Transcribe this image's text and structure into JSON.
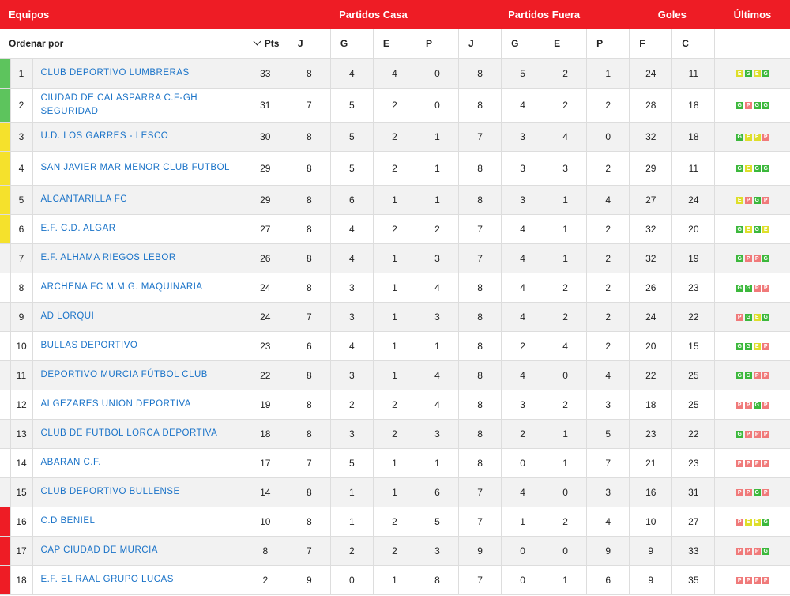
{
  "header": {
    "teams": "Equipos",
    "home": "Partidos Casa",
    "away": "Partidos Fuera",
    "goals": "Goles",
    "last": "Últimos"
  },
  "subheader": {
    "sort_by": "Ordenar por",
    "pts": "Pts",
    "home_cols": [
      "J",
      "G",
      "E",
      "P"
    ],
    "away_cols": [
      "J",
      "G",
      "E",
      "P"
    ],
    "goal_cols": [
      "F",
      "C"
    ]
  },
  "colors": {
    "accent": "#ee1c25",
    "link": "#1a73c8",
    "zone_green": "#5dc45d",
    "zone_yellow": "#f5e12c",
    "zone_red": "#ee1c25",
    "result_win": "#3cb83c",
    "result_draw": "#dede2a",
    "result_loss": "#f07a7a"
  },
  "rows": [
    {
      "pos": "1",
      "team": "CLUB DEPORTIVO LUMBRERAS",
      "pts": "33",
      "home": [
        "8",
        "4",
        "4",
        "0"
      ],
      "away": [
        "8",
        "5",
        "2",
        "1"
      ],
      "gf": "24",
      "ga": "11",
      "zone": "green",
      "last": [
        "E",
        "G",
        "E",
        "G"
      ]
    },
    {
      "pos": "2",
      "team": "CIUDAD DE CALASPARRA C.F-GH SEGURIDAD",
      "pts": "31",
      "home": [
        "7",
        "5",
        "2",
        "0"
      ],
      "away": [
        "8",
        "4",
        "2",
        "2"
      ],
      "gf": "28",
      "ga": "18",
      "zone": "green",
      "last": [
        "G",
        "P",
        "G",
        "G"
      ]
    },
    {
      "pos": "3",
      "team": "U.D. LOS GARRES - LESCO",
      "pts": "30",
      "home": [
        "8",
        "5",
        "2",
        "1"
      ],
      "away": [
        "7",
        "3",
        "4",
        "0"
      ],
      "gf": "32",
      "ga": "18",
      "zone": "yellow",
      "last": [
        "G",
        "E",
        "E",
        "P"
      ]
    },
    {
      "pos": "4",
      "team": "SAN JAVIER MAR MENOR CLUB FUTBOL",
      "pts": "29",
      "home": [
        "8",
        "5",
        "2",
        "1"
      ],
      "away": [
        "8",
        "3",
        "3",
        "2"
      ],
      "gf": "29",
      "ga": "11",
      "zone": "yellow",
      "last": [
        "G",
        "E",
        "G",
        "G"
      ]
    },
    {
      "pos": "5",
      "team": "ALCANTARILLA FC",
      "pts": "29",
      "home": [
        "8",
        "6",
        "1",
        "1"
      ],
      "away": [
        "8",
        "3",
        "1",
        "4"
      ],
      "gf": "27",
      "ga": "24",
      "zone": "yellow",
      "last": [
        "E",
        "P",
        "G",
        "P"
      ]
    },
    {
      "pos": "6",
      "team": "E.F. C.D. ALGAR",
      "pts": "27",
      "home": [
        "8",
        "4",
        "2",
        "2"
      ],
      "away": [
        "7",
        "4",
        "1",
        "2"
      ],
      "gf": "32",
      "ga": "20",
      "zone": "yellow",
      "last": [
        "G",
        "E",
        "G",
        "E"
      ]
    },
    {
      "pos": "7",
      "team": "E.F. ALHAMA RIEGOS LEBOR",
      "pts": "26",
      "home": [
        "8",
        "4",
        "1",
        "3"
      ],
      "away": [
        "7",
        "4",
        "1",
        "2"
      ],
      "gf": "32",
      "ga": "19",
      "zone": "none",
      "last": [
        "G",
        "P",
        "P",
        "G"
      ]
    },
    {
      "pos": "8",
      "team": "ARCHENA FC M.M.G. MAQUINARIA",
      "pts": "24",
      "home": [
        "8",
        "3",
        "1",
        "4"
      ],
      "away": [
        "8",
        "4",
        "2",
        "2"
      ],
      "gf": "26",
      "ga": "23",
      "zone": "none",
      "last": [
        "G",
        "G",
        "P",
        "P"
      ]
    },
    {
      "pos": "9",
      "team": "AD LORQUI",
      "pts": "24",
      "home": [
        "7",
        "3",
        "1",
        "3"
      ],
      "away": [
        "8",
        "4",
        "2",
        "2"
      ],
      "gf": "24",
      "ga": "22",
      "zone": "none",
      "last": [
        "P",
        "G",
        "E",
        "G"
      ]
    },
    {
      "pos": "10",
      "team": "BULLAS DEPORTIVO",
      "pts": "23",
      "home": [
        "6",
        "4",
        "1",
        "1"
      ],
      "away": [
        "8",
        "2",
        "4",
        "2"
      ],
      "gf": "20",
      "ga": "15",
      "zone": "none",
      "last": [
        "G",
        "G",
        "E",
        "P"
      ]
    },
    {
      "pos": "11",
      "team": "DEPORTIVO MURCIA FÚTBOL CLUB",
      "pts": "22",
      "home": [
        "8",
        "3",
        "1",
        "4"
      ],
      "away": [
        "8",
        "4",
        "0",
        "4"
      ],
      "gf": "22",
      "ga": "25",
      "zone": "none",
      "last": [
        "G",
        "G",
        "P",
        "P"
      ]
    },
    {
      "pos": "12",
      "team": "ALGEZARES UNION DEPORTIVA",
      "pts": "19",
      "home": [
        "8",
        "2",
        "2",
        "4"
      ],
      "away": [
        "8",
        "3",
        "2",
        "3"
      ],
      "gf": "18",
      "ga": "25",
      "zone": "none",
      "last": [
        "P",
        "P",
        "G",
        "P"
      ]
    },
    {
      "pos": "13",
      "team": "CLUB DE FUTBOL LORCA DEPORTIVA",
      "pts": "18",
      "home": [
        "8",
        "3",
        "2",
        "3"
      ],
      "away": [
        "8",
        "2",
        "1",
        "5"
      ],
      "gf": "23",
      "ga": "22",
      "zone": "none",
      "last": [
        "G",
        "P",
        "P",
        "P"
      ]
    },
    {
      "pos": "14",
      "team": "ABARAN C.F.",
      "pts": "17",
      "home": [
        "7",
        "5",
        "1",
        "1"
      ],
      "away": [
        "8",
        "0",
        "1",
        "7"
      ],
      "gf": "21",
      "ga": "23",
      "zone": "none",
      "last": [
        "P",
        "P",
        "P",
        "P"
      ]
    },
    {
      "pos": "15",
      "team": "CLUB DEPORTIVO BULLENSE",
      "pts": "14",
      "home": [
        "8",
        "1",
        "1",
        "6"
      ],
      "away": [
        "7",
        "4",
        "0",
        "3"
      ],
      "gf": "16",
      "ga": "31",
      "zone": "none",
      "last": [
        "P",
        "P",
        "G",
        "P"
      ]
    },
    {
      "pos": "16",
      "team": "C.D BENIEL",
      "pts": "10",
      "home": [
        "8",
        "1",
        "2",
        "5"
      ],
      "away": [
        "7",
        "1",
        "2",
        "4"
      ],
      "gf": "10",
      "ga": "27",
      "zone": "red",
      "last": [
        "P",
        "E",
        "E",
        "G"
      ]
    },
    {
      "pos": "17",
      "team": "CAP CIUDAD DE MURCIA",
      "pts": "8",
      "home": [
        "7",
        "2",
        "2",
        "3"
      ],
      "away": [
        "9",
        "0",
        "0",
        "9"
      ],
      "gf": "9",
      "ga": "33",
      "zone": "red",
      "last": [
        "P",
        "P",
        "P",
        "G"
      ]
    },
    {
      "pos": "18",
      "team": "E.F. EL RAAL GRUPO LUCAS",
      "pts": "2",
      "home": [
        "9",
        "0",
        "1",
        "8"
      ],
      "away": [
        "7",
        "0",
        "1",
        "6"
      ],
      "gf": "9",
      "ga": "35",
      "zone": "red",
      "last": [
        "P",
        "P",
        "P",
        "P"
      ]
    }
  ]
}
